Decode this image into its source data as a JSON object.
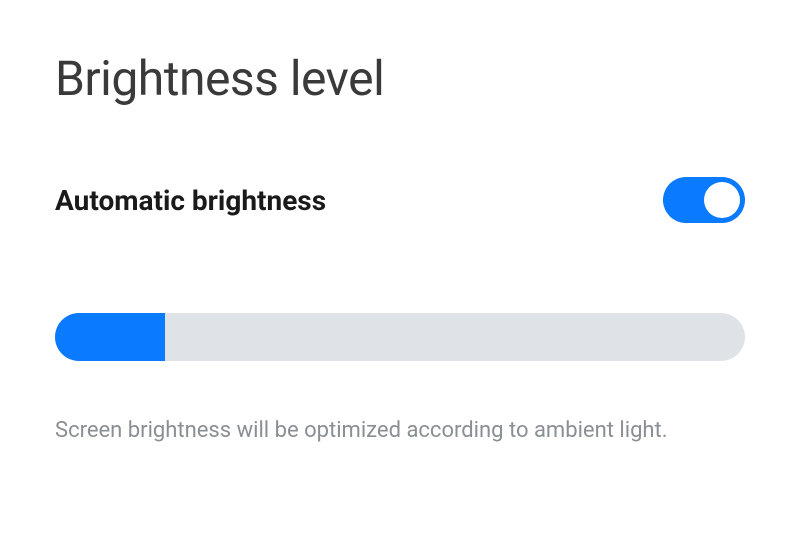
{
  "title": "Brightness level",
  "settings": {
    "autoBrightness": {
      "label": "Automatic brightness",
      "enabled": true
    }
  },
  "slider": {
    "percent": 16
  },
  "description": "Screen brightness will be optimized according to ambient light.",
  "colors": {
    "accent": "#0a7aff",
    "track": "#dfe3e8"
  }
}
